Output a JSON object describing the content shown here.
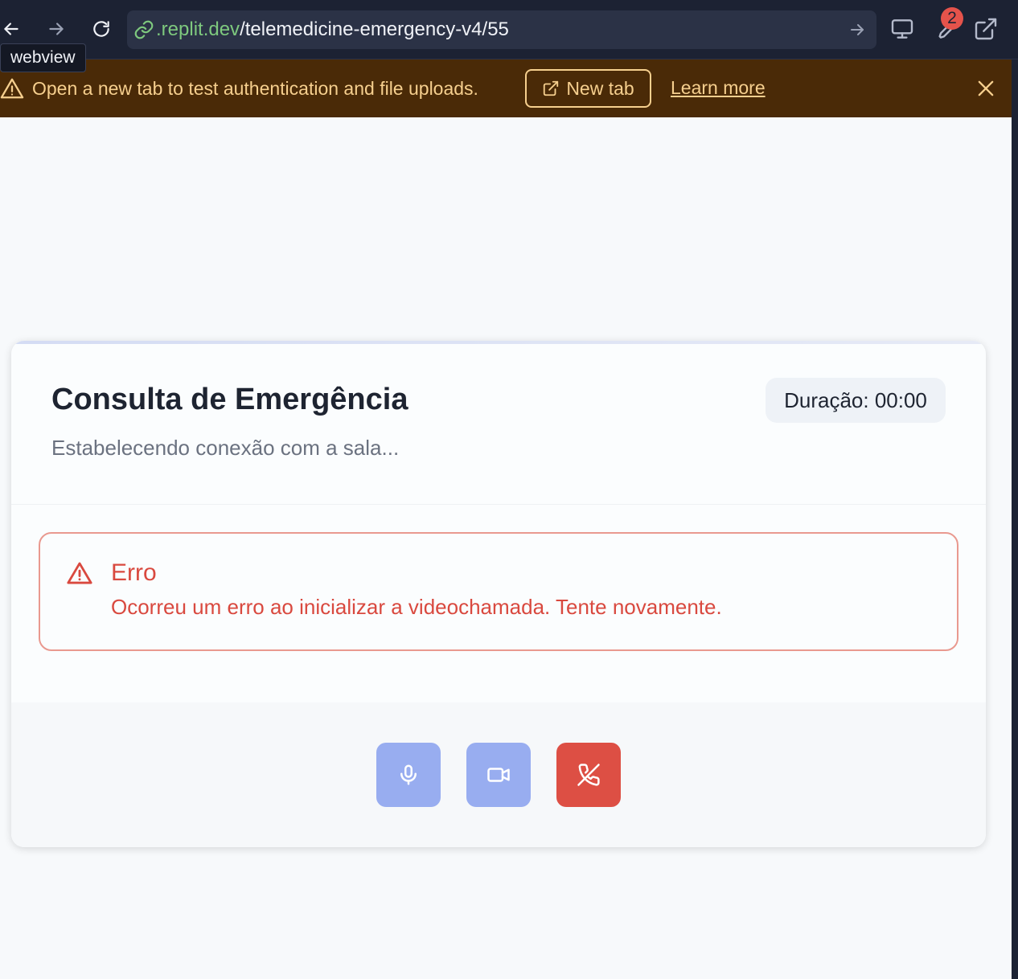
{
  "browser": {
    "url_domain": ".replit.dev",
    "url_path": "/telemedicine-emergency-v4/55",
    "tooltip": "webview",
    "badge_count": "2"
  },
  "banner": {
    "message": "Open a new tab to test authentication and file uploads.",
    "new_tab_label": "New tab",
    "learn_more_label": "Learn more"
  },
  "card": {
    "title": "Consulta de Emergência",
    "subtitle": "Estabelecendo conexão com a sala...",
    "duration": "Duração: 00:00"
  },
  "alert": {
    "title": "Erro",
    "message": "Ocorreu um erro ao inicializar a videochamada. Tente novamente."
  },
  "controls": {
    "mic_icon": "mic-icon",
    "camera_icon": "video-icon",
    "end_call_icon": "phone-off-icon"
  },
  "colors": {
    "banner_bg": "#4a2a07",
    "banner_text": "#f6cf8e",
    "error": "#d9493f",
    "control_blue": "#98adf0",
    "control_red": "#dd4f44",
    "url_domain": "#7ec97e"
  }
}
